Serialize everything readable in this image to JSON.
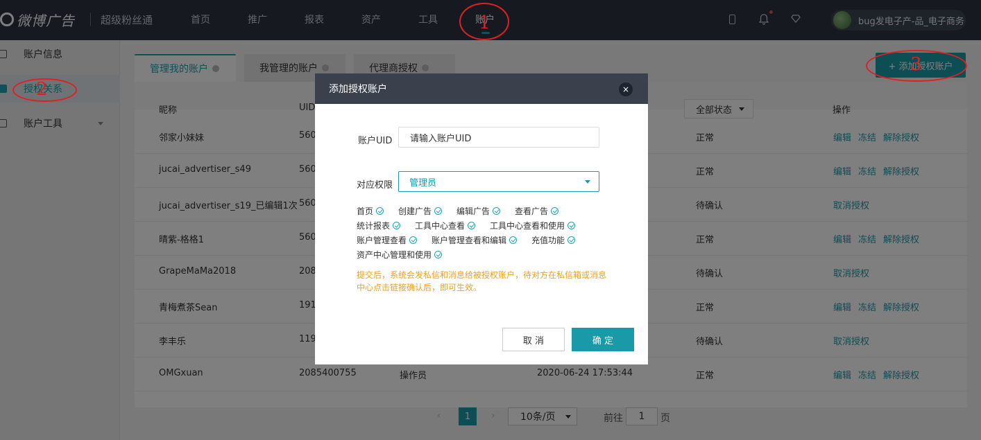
{
  "topbar": {
    "brand": "微博广告",
    "product": "超级粉丝通",
    "nav": [
      "首页",
      "推广",
      "报表",
      "资产",
      "工具",
      "账户"
    ],
    "active_nav": "账户",
    "username": "bug发电子产-品_电子商务"
  },
  "sidebar": {
    "items": [
      {
        "label": "账户信息"
      },
      {
        "label": "授权关系"
      },
      {
        "label": "账户工具"
      }
    ]
  },
  "tabs": [
    "管理我的账户",
    "我管理的账户",
    "代理商授权"
  ],
  "add_button": "+ 添加授权账户",
  "table": {
    "headers": [
      "昵称",
      "UID",
      "操作"
    ],
    "status_filter": "全部状态",
    "rows": [
      {
        "name": "邻家小妹妹",
        "uid": "560",
        "role": "",
        "time": "",
        "status": "正常",
        "actions": [
          "编辑",
          "冻结",
          "解除授权"
        ]
      },
      {
        "name": "jucai_advertiser_s49",
        "uid": "560",
        "role": "",
        "time": "",
        "status": "正常",
        "actions": [
          "编辑",
          "冻结",
          "解除授权"
        ]
      },
      {
        "name": "jucai_advertiser_s19_已编辑1次",
        "uid": "560",
        "role": "",
        "time": "",
        "status": "待确认",
        "actions": [
          "取消授权"
        ]
      },
      {
        "name": "晴紫-格格1",
        "uid": "560",
        "role": "",
        "time": "",
        "status": "正常",
        "actions": [
          "编辑",
          "冻结",
          "解除授权"
        ]
      },
      {
        "name": "GrapeMaMa2018",
        "uid": "208",
        "role": "",
        "time": "",
        "status": "待确认",
        "actions": [
          "取消授权"
        ]
      },
      {
        "name": "青梅煮茶Sean",
        "uid": "191",
        "role": "",
        "time": "",
        "status": "正常",
        "actions": [
          "编辑",
          "冻结",
          "解除授权"
        ]
      },
      {
        "name": "李丰乐",
        "uid": "119",
        "role": "",
        "time": "",
        "status": "待确认",
        "actions": [
          "取消授权"
        ]
      },
      {
        "name": "OMGxuan",
        "uid": "2085400755",
        "role": "操作员",
        "time": "2020-06-24 17:53:44",
        "status": "正常",
        "actions": [
          "编辑",
          "冻结",
          "解除授权"
        ]
      }
    ]
  },
  "pager": {
    "prev": "‹",
    "next": "›",
    "current": "1",
    "page_size": "10条/页",
    "goto_prefix": "前往",
    "goto_value": "1",
    "goto_suffix": "页"
  },
  "modal": {
    "title": "添加授权账户",
    "close": "×",
    "uid_label": "账户UID",
    "uid_placeholder": "请输入账户UID",
    "role_label": "对应权限",
    "role_value": "管理员",
    "permissions": [
      [
        "首页",
        "创建广告",
        "编辑广告",
        "查看广告"
      ],
      [
        "统计报表",
        "工具中心查看",
        "工具中心查看和使用"
      ],
      [
        "账户管理查看",
        "账户管理查看和编辑",
        "充值功能"
      ],
      [
        "资产中心管理和使用"
      ]
    ],
    "notice": "提交后，系统会发私信和消息给被授权账户，待对方在私信箱或消息中心点击链接确认后，即可生效。",
    "cancel": "取 消",
    "ok": "确 定"
  },
  "annotations": [
    "1",
    "2",
    "3"
  ],
  "colors": {
    "accent": "#1a9aa8",
    "topbar": "#2c3440",
    "warning": "#f0a020",
    "annotation": "#e02020"
  }
}
